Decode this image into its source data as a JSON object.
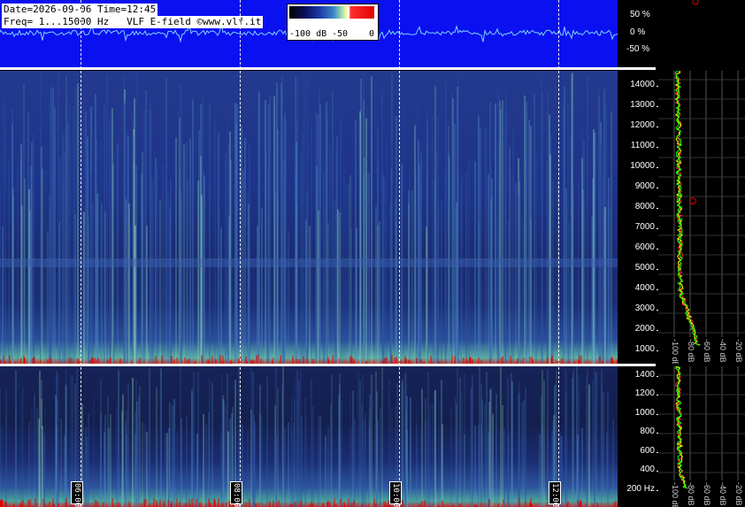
{
  "header": {
    "line1": "Date=2026-09-06 Time=12:45",
    "line2": "Freq= 1...15000 Hz   VLF E-field ©www.vlf.it"
  },
  "colorbar": {
    "labels": [
      "-100 dB",
      "-50",
      "0"
    ]
  },
  "waveform_axis": [
    "50 %",
    "0 %",
    "-50 %"
  ],
  "freq_axis_upper": [
    "14000",
    "13000",
    "12000",
    "11000",
    "10000",
    "9000",
    "8000",
    "7000",
    "6000",
    "5000",
    "4000",
    "3000",
    "2000",
    "1000"
  ],
  "freq_axis_lower": [
    "1400",
    "1200",
    "1000",
    "800",
    "600",
    "400",
    "200 Hz"
  ],
  "db_axis_upper": [
    "-100 dB",
    "-80 dB",
    "-60 dB",
    "-40 dB",
    "-20 dB"
  ],
  "db_axis_lower": [
    "-100 dB",
    "-80 dB",
    "-60 dB",
    "-40 dB",
    "-20 dB"
  ],
  "time_labels": [
    "06:00",
    "08:00",
    "10:00",
    "12:00"
  ],
  "colors": {
    "background_blue": "#0a10f0",
    "waveform": "#7fd0ff",
    "alert_red": "#e00000",
    "spectrum_trace_a": "#ffff00",
    "spectrum_trace_b": "#00ff00",
    "spectrum_trace_c": "#ff3030"
  }
}
